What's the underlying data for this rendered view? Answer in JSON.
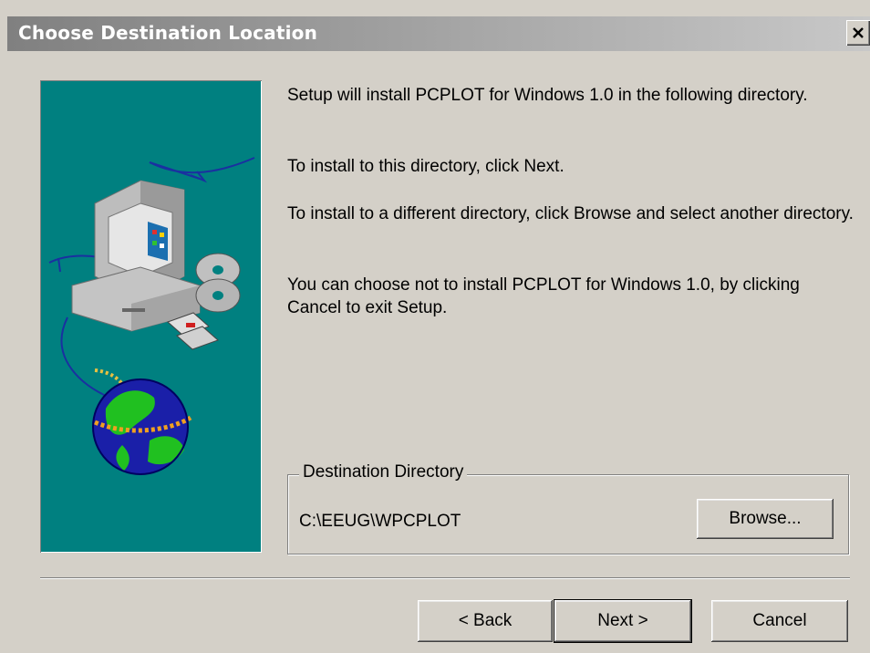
{
  "window": {
    "title": "Choose Destination Location",
    "close_glyph": "✕"
  },
  "message": {
    "line1": "Setup will install PCPLOT for Windows 1.0 in the following directory.",
    "line2": "To install to this directory, click Next.",
    "line3": "To install to a different directory, click Browse and select another directory.",
    "line4": "You can choose not to install PCPLOT for Windows 1.0, by clicking Cancel to exit Setup."
  },
  "destination": {
    "group_label": "Destination Directory",
    "path": "C:\\EEUG\\WPCPLOT",
    "browse_label": "Browse..."
  },
  "buttons": {
    "back": "< Back",
    "next": "Next >",
    "cancel": "Cancel"
  },
  "colors": {
    "panel_bg": "#008080",
    "dialog_bg": "#d4d0c8",
    "titlebar": "#808080"
  },
  "icons": {
    "illustration": "computer-cd-globe-illustration",
    "close": "close-icon"
  }
}
